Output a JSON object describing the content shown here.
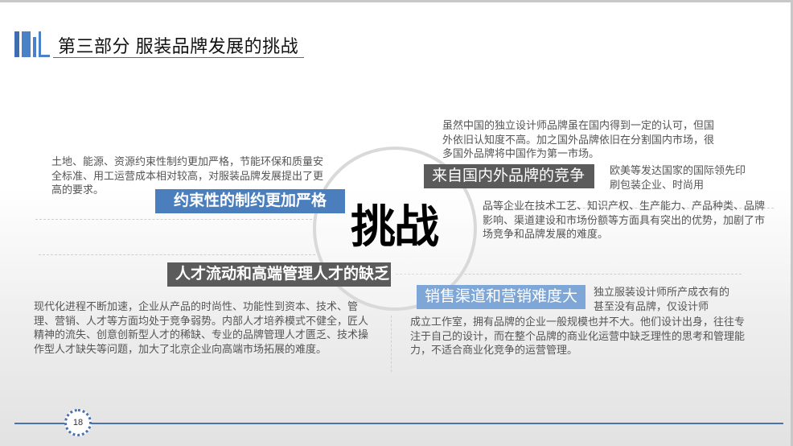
{
  "header": {
    "title": "第三部分 服装品牌发展的挑战"
  },
  "center": {
    "word": "挑战"
  },
  "sections": {
    "constraint": {
      "label": "约束性的制约更加严格",
      "text": "土地、能源、资源约束性制约更加严格，节能环保和质量安全标准、用工运营成本相对较高，对服装品牌发展提出了更高的要求。"
    },
    "competition": {
      "label": "来自国内外品牌的竞争",
      "text_top": "虽然中国的独立设计师品牌虽在国内得到一定的认可，但国外依旧认知度不高。加之国外品牌依旧在分割国内市场，很多国外品牌将中国作为第一市场。",
      "text_right": "欧美等发达国家的国际领先印刷包装企业、时尚用",
      "text_bottom": "品等企业在技术工艺、知识产权、生产能力、产品种类、品牌影响、渠道建设和市场份额等方面具有突出的优势，加剧了市场竞争和品牌发展的难度。"
    },
    "talent": {
      "label": "人才流动和高端管理人才的缺乏",
      "text": "现代化进程不断加速，企业从产品的时尚性、功能性到资本、技术、管理、营销、人才等方面均处于竞争弱势。内部人才培养模式不健全，匠人精神的流失、创意创新型人才的稀缺、专业的品牌管理人才匮乏、技术操作型人才缺失等问题，加大了北京企业向高端市场拓展的难度。"
    },
    "channel": {
      "label": "销售渠道和营销难度大",
      "text_right": "独立服装设计师所产成衣有的甚至没有品牌，仅设计师",
      "text_bottom": "成立工作室，拥有品牌的企业一般规模也并不大。他们设计出身，往往专注于自己的设计，而在整个品牌的商业化运营中缺乏理性的思考和管理能力，不适合商业化竞争的运营管理。"
    }
  },
  "footer": {
    "page_number": "18"
  },
  "colors": {
    "accent_blue": "#4a7ebd",
    "label_dark": "#5b5b5b",
    "label_light": "#7ea6d6"
  }
}
